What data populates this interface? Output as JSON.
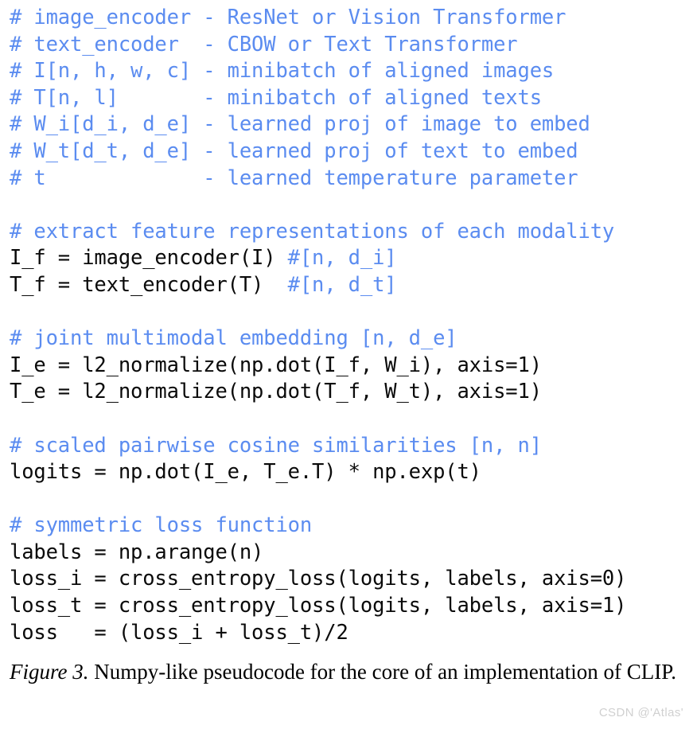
{
  "figure": {
    "caption_label": "Figure 3.",
    "caption_text": " Numpy-like pseudocode for the core of an implementation of CLIP.",
    "watermark": "CSDN @'Atlas'"
  },
  "code": {
    "language": "python-pseudocode",
    "lines": [
      {
        "comment": "# image_encoder - ResNet or Vision Transformer",
        "code": ""
      },
      {
        "comment": "# text_encoder  - CBOW or Text Transformer",
        "code": ""
      },
      {
        "comment": "# I[n, h, w, c] - minibatch of aligned images",
        "code": ""
      },
      {
        "comment": "# T[n, l]       - minibatch of aligned texts",
        "code": ""
      },
      {
        "comment": "# W_i[d_i, d_e] - learned proj of image to embed",
        "code": ""
      },
      {
        "comment": "# W_t[d_t, d_e] - learned proj of text to embed",
        "code": ""
      },
      {
        "comment": "# t             - learned temperature parameter",
        "code": ""
      },
      {
        "comment": "",
        "code": ""
      },
      {
        "comment": "# extract feature representations of each modality",
        "code": ""
      },
      {
        "code": "I_f = image_encoder(I) ",
        "comment": "#[n, d_i]"
      },
      {
        "code": "T_f = text_encoder(T)  ",
        "comment": "#[n, d_t]"
      },
      {
        "comment": "",
        "code": ""
      },
      {
        "comment": "# joint multimodal embedding [n, d_e]",
        "code": ""
      },
      {
        "code": "I_e = l2_normalize(np.dot(I_f, W_i), axis=1)",
        "comment": ""
      },
      {
        "code": "T_e = l2_normalize(np.dot(T_f, W_t), axis=1)",
        "comment": ""
      },
      {
        "comment": "",
        "code": ""
      },
      {
        "comment": "# scaled pairwise cosine similarities [n, n]",
        "code": ""
      },
      {
        "code": "logits = np.dot(I_e, T_e.T) * np.exp(t)",
        "comment": ""
      },
      {
        "comment": "",
        "code": ""
      },
      {
        "comment": "# symmetric loss function",
        "code": ""
      },
      {
        "code": "labels = np.arange(n)",
        "comment": ""
      },
      {
        "code": "loss_i = cross_entropy_loss(logits, labels, axis=0)",
        "comment": ""
      },
      {
        "code": "loss_t = cross_entropy_loss(logits, labels, axis=1)",
        "comment": ""
      },
      {
        "code": "loss   = (loss_i + loss_t)/2",
        "comment": ""
      }
    ]
  },
  "colors": {
    "comment": "#5b8cf0",
    "code": "#0a0a0a",
    "background": "#ffffff",
    "watermark": "#d0d0d0"
  }
}
